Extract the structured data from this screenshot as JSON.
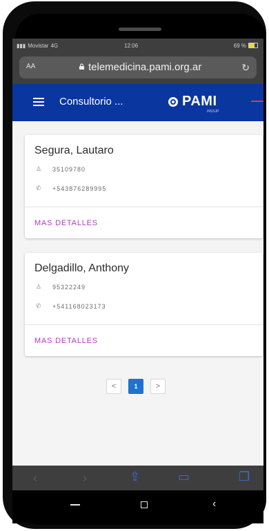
{
  "status": {
    "carrier": "Movistar",
    "network": "4G",
    "time": "12:06",
    "battery_text": "69 %",
    "battery_level": 0.69
  },
  "browser": {
    "aa_label": "AA",
    "url": "telemedicina.pami.org.ar"
  },
  "header": {
    "title": "Consultorio ...",
    "brand": "PAMI",
    "brand_sub": "INSSJP"
  },
  "patients": [
    {
      "name": "Segura, Lautaro",
      "dni": "35109780",
      "phone": "+543876289995",
      "more": "MAS DETALLES"
    },
    {
      "name": "Delgadillo, Anthony",
      "dni": "95322249",
      "phone": "+541168023173",
      "more": "MAS DETALLES"
    }
  ],
  "pagination": {
    "prev": "<",
    "current": "1",
    "next": ">"
  },
  "colors": {
    "header_bg": "#0a36a0",
    "accent": "#b536c6",
    "page_active": "#1e74cc"
  }
}
